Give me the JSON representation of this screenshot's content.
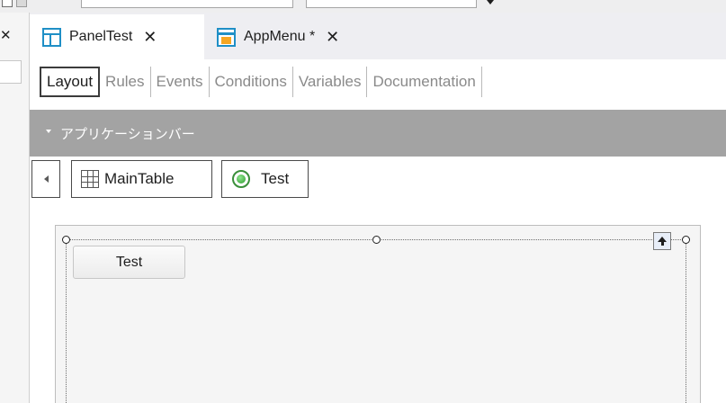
{
  "window": {
    "tabs": [
      {
        "label": "PanelTest",
        "icon": "panel-object-icon",
        "active": true
      },
      {
        "label": "AppMenu *",
        "icon": "app-menu-object-icon",
        "active": false
      }
    ],
    "close_glyph": "✕"
  },
  "left_panel": {
    "close_glyph": "✕"
  },
  "subtabs": [
    "Layout",
    "Rules",
    "Events",
    "Conditions",
    "Variables",
    "Documentation"
  ],
  "active_subtab": "Layout",
  "appbar": {
    "title": "アプリケーションバー",
    "collapsed_icon": "caret-down-icon"
  },
  "breadcrumb": {
    "items": [
      {
        "label": "MainTable",
        "icon": "table-grid-icon"
      },
      {
        "label": "Test",
        "icon": "radio-button-icon"
      }
    ]
  },
  "canvas": {
    "button_label": "Test"
  },
  "colors": {
    "accent": "#1f8fc6",
    "appbar_bg": "#a3a3a3",
    "tabstrip_bg": "#eeeef2"
  }
}
